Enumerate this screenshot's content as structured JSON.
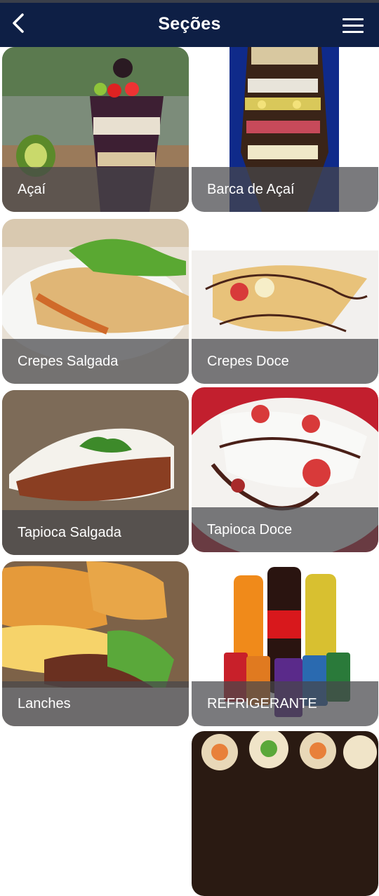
{
  "header": {
    "title": "Seções",
    "back_icon": "chevron-left-icon",
    "menu_icon": "hamburger-menu-icon"
  },
  "sections": [
    {
      "label": "Açaí"
    },
    {
      "label": "Barca de Açaí"
    },
    {
      "label": "Crepes Salgada"
    },
    {
      "label": "Crepes Doce"
    },
    {
      "label": "Tapioca Salgada"
    },
    {
      "label": "Tapioca Doce"
    },
    {
      "label": "Lanches"
    },
    {
      "label": "REFRIGERANTE"
    },
    {
      "label": ""
    }
  ],
  "colors": {
    "header_bg": "#0e1f45",
    "caption_bg": "#46464b",
    "page_bg": "#ffffff"
  }
}
